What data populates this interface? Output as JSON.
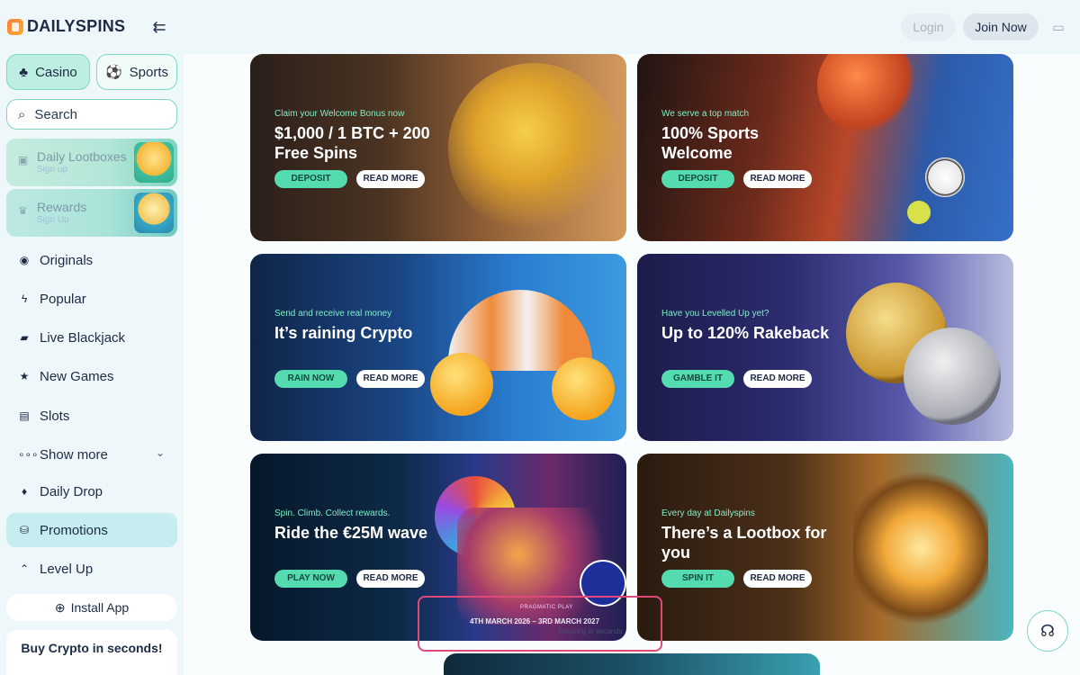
{
  "header": {
    "brand": "DAILYSPINS",
    "login_label": "Login",
    "join_label": "Join Now"
  },
  "sidebar": {
    "tabs": [
      {
        "label": "Casino",
        "icon": "casino-icon",
        "active": true
      },
      {
        "label": "Sports",
        "icon": "sports-icon",
        "active": false
      }
    ],
    "search_placeholder": "Search",
    "promo_cards": [
      {
        "title": "Daily Lootboxes",
        "subtitle": "Sign up",
        "icon": "gift-icon"
      },
      {
        "title": "Rewards",
        "subtitle": "Sign Up",
        "icon": "trophy-icon"
      }
    ],
    "items": [
      {
        "label": "Originals",
        "icon": "originals-icon"
      },
      {
        "label": "Popular",
        "icon": "bolt-icon"
      },
      {
        "label": "Live Blackjack",
        "icon": "cards-icon"
      },
      {
        "label": "New Games",
        "icon": "star-icon"
      },
      {
        "label": "Slots",
        "icon": "slots-icon"
      },
      {
        "label": "Show more",
        "icon": "dots-icon"
      },
      {
        "label": "Daily Drop",
        "icon": "drop-icon"
      },
      {
        "label": "Promotions",
        "icon": "promotions-icon",
        "active": true
      },
      {
        "label": "Level Up",
        "icon": "levelup-icon"
      }
    ],
    "install_label": "Install App",
    "buy_crypto": "Buy Crypto in seconds!"
  },
  "promos": [
    {
      "eyebrow": "Claim your Welcome Bonus now",
      "title": "$1,000 / 1 BTC + 200 Free Spins",
      "cta": "DEPOSIT",
      "more": "READ MORE"
    },
    {
      "eyebrow": "We serve a top match",
      "title": "100% Sports Welcome",
      "cta": "DEPOSIT",
      "more": "READ MORE"
    },
    {
      "eyebrow": "Send and receive real money",
      "title": "It’s raining Crypto",
      "cta": "RAIN NOW",
      "more": "READ MORE"
    },
    {
      "eyebrow": "Have you Levelled Up yet?",
      "title": "Up to 120% Rakeback",
      "cta": "GAMBLE IT",
      "more": "READ MORE"
    },
    {
      "eyebrow": "Spin. Climb. Collect rewards.",
      "title": "Ride the €25M wave",
      "cta": "PLAY NOW",
      "more": "READ MORE"
    },
    {
      "eyebrow": "Every day at Dailyspins",
      "title": "There’s a Lootbox for you",
      "cta": "SPIN IT",
      "more": "READ MORE"
    }
  ],
  "event_banner": {
    "provider": "PRAGMATIC PLAY",
    "dates": "4TH MARCH 2026 – 3RD MARCH 2027",
    "note": "Relaxing in seconds"
  },
  "colors": {
    "accent": "#54dcb0",
    "sidebar_bg": "#eef7fa",
    "highlight": "#e0487a"
  }
}
